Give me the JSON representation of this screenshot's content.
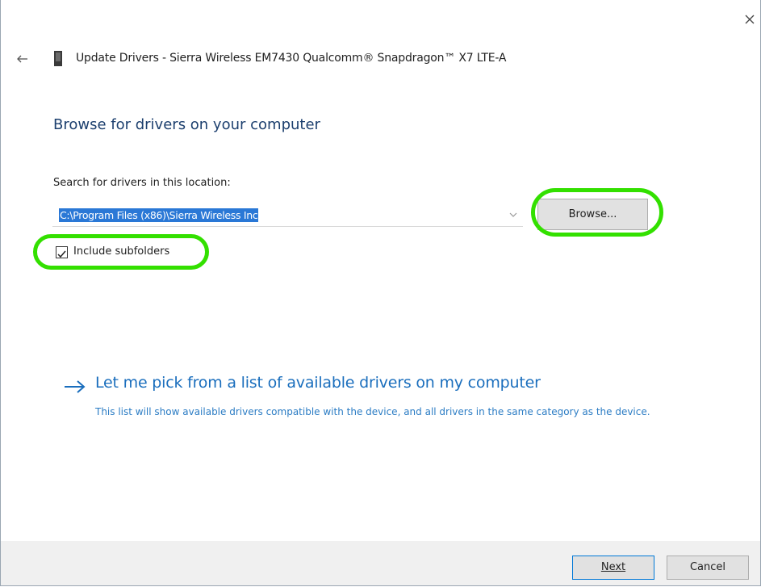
{
  "window": {
    "title": "Update Drivers - Sierra Wireless EM7430 Qualcomm® Snapdragon™ X7 LTE-A"
  },
  "page": {
    "heading": "Browse for drivers on your computer",
    "search_label": "Search for drivers in this location:",
    "path_value": "C:\\Program Files (x86)\\Sierra Wireless Inc",
    "browse_label": "Browse...",
    "include_subfolders_label": "Include subfolders",
    "include_subfolders_checked": true
  },
  "pick_option": {
    "title": "Let me pick from a list of available drivers on my computer",
    "description": "This list will show available drivers compatible with the device, and all drivers in the same category as the device."
  },
  "footer": {
    "next_label": "Next",
    "cancel_label": "Cancel"
  },
  "icons": {
    "close": "close-icon",
    "back": "back-arrow-icon",
    "device": "device-icon",
    "chevron": "chevron-down-icon",
    "checkmark": "checkmark-icon",
    "pick_arrow": "right-arrow-icon"
  },
  "colors": {
    "heading": "#1c3f6e",
    "link": "#1a6ebd",
    "selection": "#2a78d6",
    "highlight": "#33e000",
    "footer_bg": "#f0f0f0"
  }
}
